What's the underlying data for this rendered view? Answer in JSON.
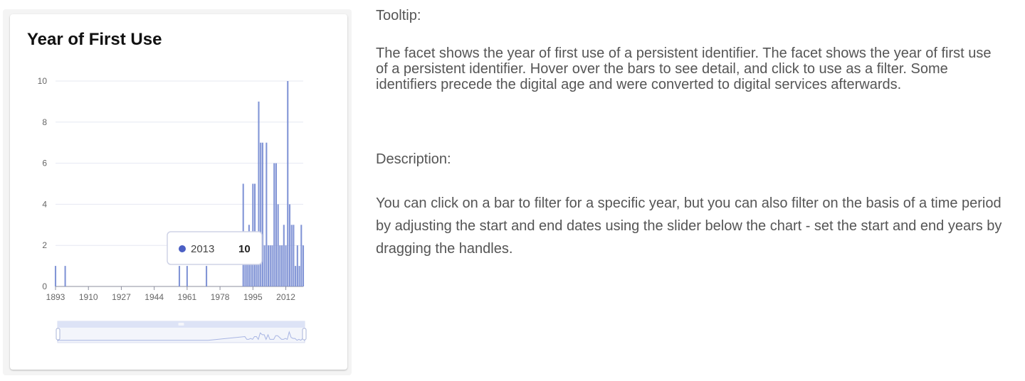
{
  "card": {
    "title": "Year of First Use"
  },
  "chart_data": {
    "type": "bar",
    "title": "Year of First Use",
    "xlabel": "",
    "ylabel": "",
    "xlim": [
      1893,
      2021
    ],
    "ylim": [
      0,
      10
    ],
    "x_ticks": [
      1893,
      1910,
      1927,
      1944,
      1961,
      1978,
      1995,
      2012
    ],
    "y_ticks": [
      0,
      2,
      4,
      6,
      8,
      10
    ],
    "grid": true,
    "bar_color": "#7b8fd4",
    "x": [
      1893,
      1898,
      1957,
      1961,
      1971,
      1990,
      1991,
      1992,
      1993,
      1994,
      1995,
      1996,
      1997,
      1998,
      1999,
      2000,
      2001,
      2002,
      2003,
      2004,
      2005,
      2006,
      2007,
      2008,
      2009,
      2010,
      2011,
      2012,
      2013,
      2014,
      2015,
      2016,
      2017,
      2018,
      2019,
      2020,
      2021
    ],
    "values": [
      1,
      1,
      1,
      1,
      1,
      5,
      2,
      2,
      3,
      2,
      5,
      5,
      2,
      9,
      7,
      7,
      2,
      7,
      2,
      2,
      2,
      6,
      6,
      4,
      2,
      2,
      3,
      2,
      10,
      4,
      3,
      3,
      1,
      2,
      1,
      3,
      2
    ],
    "tooltip": {
      "year": "2013",
      "value": "10"
    },
    "range_slider": {
      "start": 1893,
      "end": 2021
    }
  },
  "info": {
    "tooltip_heading": "Tooltip:",
    "tooltip_text": "The facet shows the year of first use of a persistent identifier. The facet shows the year of first use of a persistent identifier. Hover over the bars to see detail, and click to use as a filter. Some identifiers precede the digital age and were converted to digital services afterwards.",
    "description_heading": "Description:",
    "description_text": "You can click on a bar to filter for a specific year, but you can also filter on the basis of a time period by adjusting the start and end dates using the slider below the chart - set the start and end years by dragging the handles."
  }
}
